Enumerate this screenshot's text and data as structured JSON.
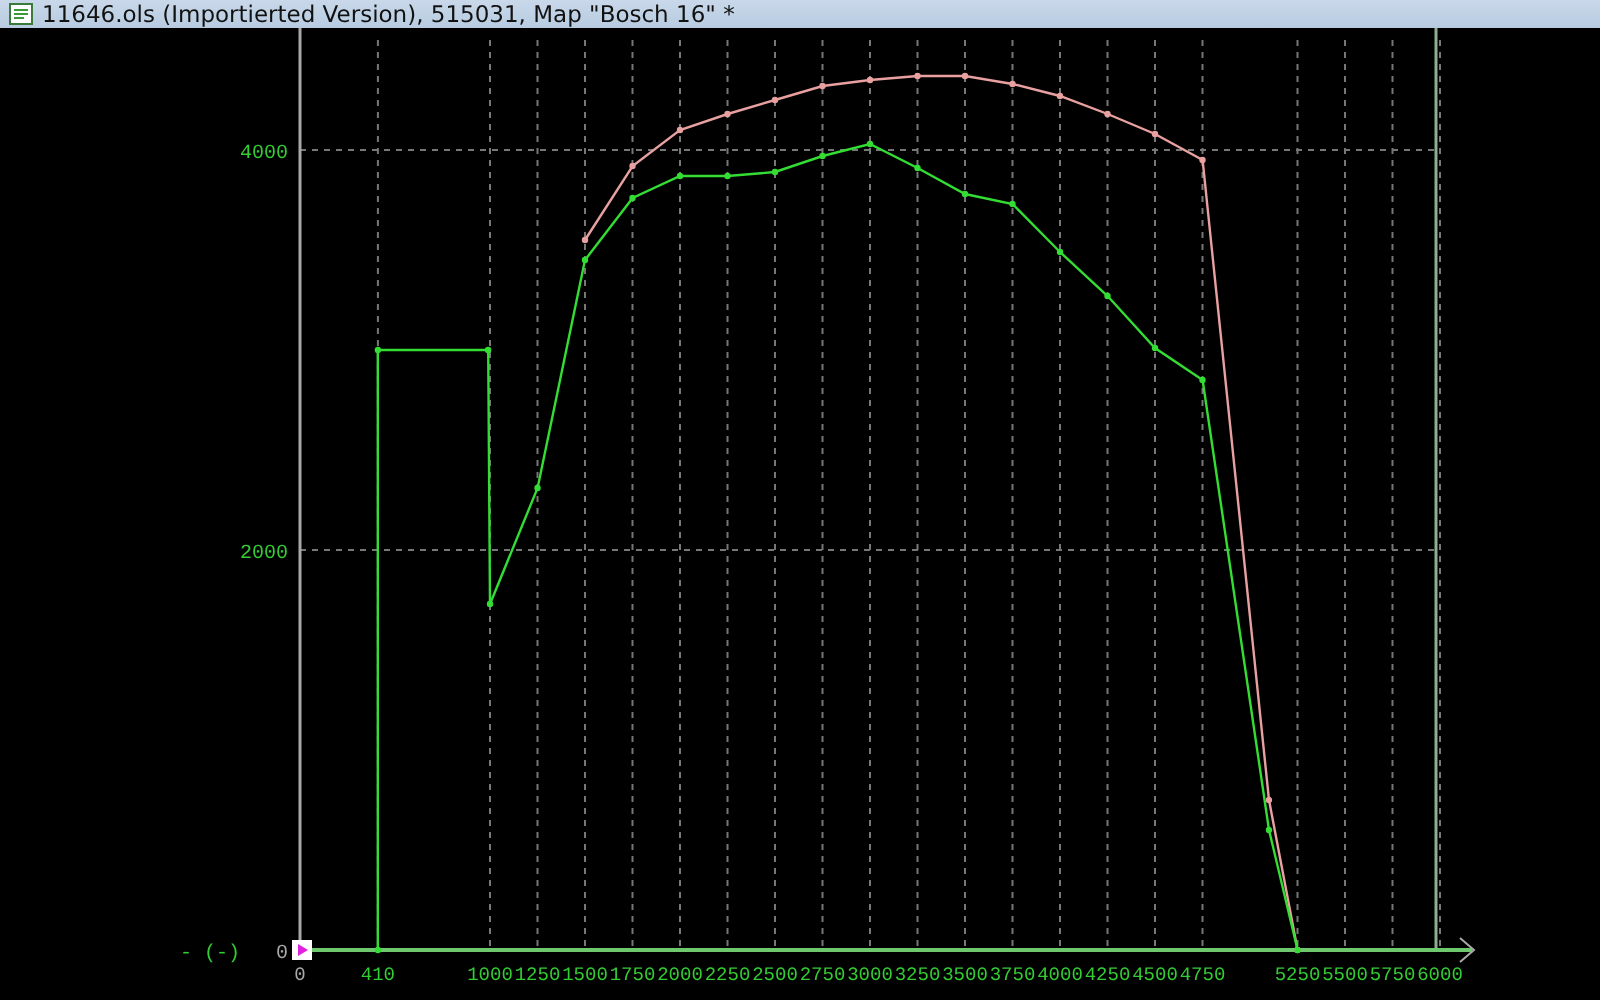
{
  "window": {
    "title": "11646.ols (Importierted Version), 515031, Map \"Bosch 16\" *"
  },
  "chart": {
    "chart_data": {
      "type": "line",
      "ylabel": "- (-)",
      "x": [
        410,
        410,
        990,
        1000,
        1250,
        1500,
        1750,
        2000,
        2250,
        2500,
        2750,
        3000,
        3250,
        3500,
        3750,
        4000,
        4250,
        4500,
        4750,
        5100,
        5250
      ],
      "series": [
        {
          "color": "#e8a0a0",
          "marker": "o",
          "values": [
            null,
            null,
            null,
            null,
            null,
            3550,
            3920,
            4100,
            4180,
            4250,
            4320,
            4350,
            4370,
            4370,
            4330,
            4270,
            4180,
            4080,
            3950,
            750,
            0
          ]
        },
        {
          "color": "#33dd33",
          "marker": "o",
          "values": [
            0,
            3000,
            3000,
            1730,
            2310,
            3450,
            3760,
            3870,
            3870,
            3890,
            3970,
            4030,
            3910,
            3780,
            3730,
            3490,
            3270,
            3010,
            2850,
            600,
            0
          ]
        }
      ],
      "grid": true,
      "xlim": [
        0,
        6000
      ],
      "ylim": [
        0,
        4550
      ],
      "xticks": [
        0,
        410,
        1000,
        1250,
        1500,
        1750,
        2000,
        2250,
        2500,
        2750,
        3000,
        3250,
        3500,
        3750,
        4000,
        4250,
        4500,
        4750,
        5250,
        5500,
        5750,
        6000
      ],
      "yticks": [
        0,
        2000,
        4000
      ]
    }
  }
}
